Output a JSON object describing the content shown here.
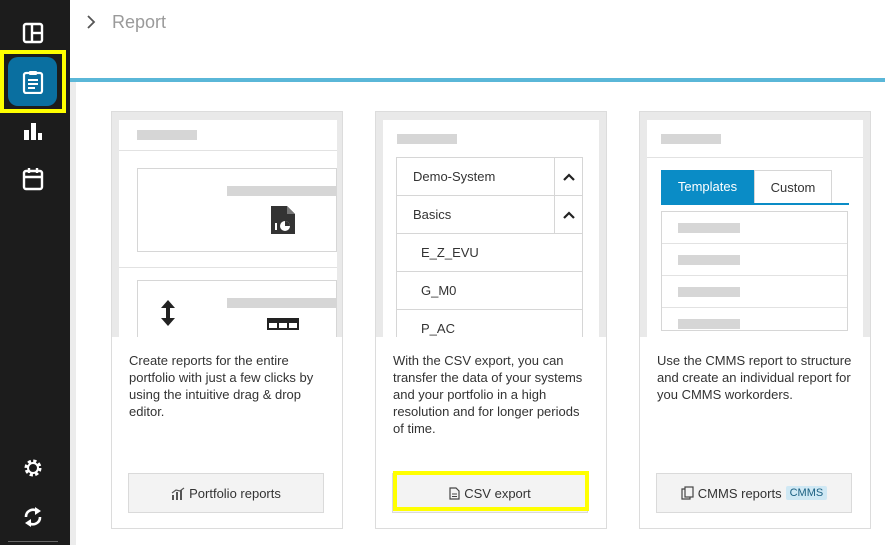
{
  "breadcrumb": {
    "current": "Report"
  },
  "sidebar": {
    "items": [
      {
        "name": "dashboard",
        "icon": "layout-icon"
      },
      {
        "name": "report",
        "icon": "clipboard-icon",
        "active": true
      },
      {
        "name": "analytics",
        "icon": "bar-chart-icon"
      },
      {
        "name": "calendar",
        "icon": "calendar-icon"
      }
    ],
    "bottom": [
      {
        "name": "settings",
        "icon": "gear-icon"
      },
      {
        "name": "sync",
        "icon": "sync-icon"
      }
    ]
  },
  "cards": [
    {
      "description": "Create reports for the entire portfolio with just a few clicks by using the intuitive drag & drop editor.",
      "button": "Portfolio reports",
      "button_icon": "bar-chart-icon"
    },
    {
      "description": "With the CSV export, you can transfer the data of your systems and your portfolio in a high resolution and for longer periods of time.",
      "button": "CSV export",
      "button_icon": "file-icon",
      "tree": [
        "Demo-System",
        "Basics",
        "E_Z_EVU",
        "G_M0",
        "P_AC"
      ]
    },
    {
      "description": "Use the CMMS report to structure and create an individual report for you CMMS workorders.",
      "button": "CMMS reports",
      "button_icon": "copy-icon",
      "badge": "CMMS",
      "tabs": [
        "Templates",
        "Custom"
      ]
    }
  ],
  "colors": {
    "accent": "#0a8cc6",
    "sidebar": "#1c1c1c",
    "highlight": "#ffff00",
    "active_nav": "#0a6fa0"
  }
}
